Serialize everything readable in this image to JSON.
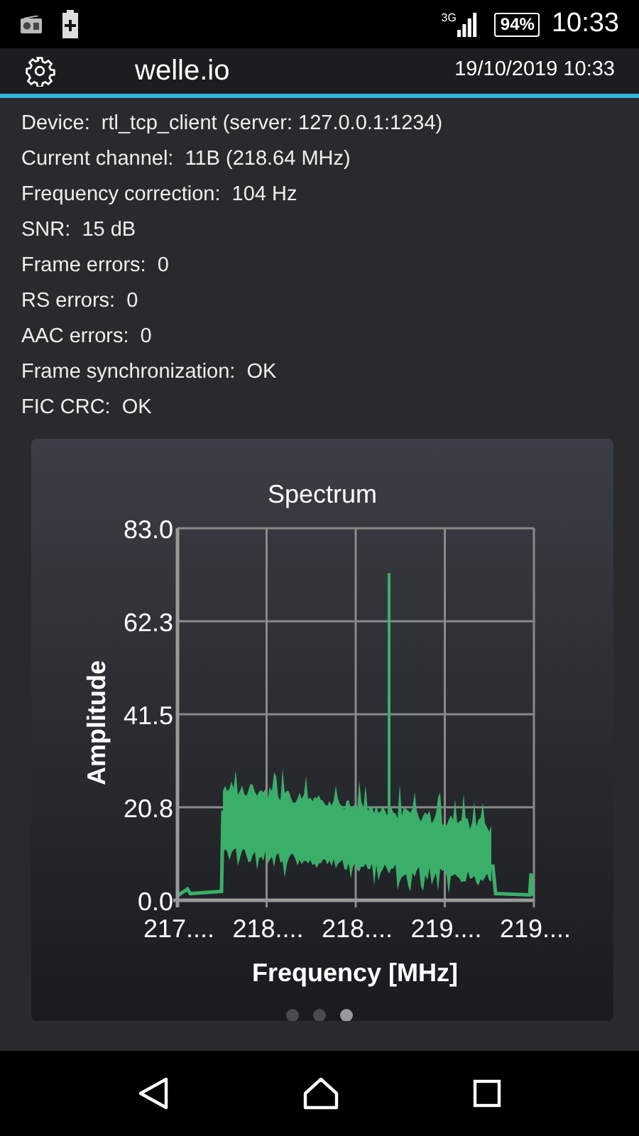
{
  "status_bar": {
    "network": "3G",
    "battery": "94%",
    "time": "10:33"
  },
  "app_bar": {
    "title": "welle.io",
    "datetime": "19/10/2019 10:33"
  },
  "info": [
    {
      "label": "Device:",
      "value": "rtl_tcp_client (server: 127.0.0.1:1234)"
    },
    {
      "label": "Current channel:",
      "value": "11B (218.64 MHz)"
    },
    {
      "label": "Frequency correction:",
      "value": "104 Hz"
    },
    {
      "label": "SNR:",
      "value": "15 dB"
    },
    {
      "label": "Frame errors:",
      "value": "0"
    },
    {
      "label": "RS errors:",
      "value": "0"
    },
    {
      "label": "AAC errors:",
      "value": "0"
    },
    {
      "label": "Frame synchronization:",
      "value": "OK"
    },
    {
      "label": "FIC CRC:",
      "value": "OK"
    }
  ],
  "spectrum": {
    "title": "Spectrum",
    "ylabel": "Amplitude",
    "xlabel": "Frequency [MHz]",
    "yticks": [
      "83.0",
      "62.3",
      "41.5",
      "20.8",
      "0.0"
    ],
    "xticks": [
      "217....",
      "218....",
      "218....",
      "219....",
      "219...."
    ]
  },
  "pages": [
    {
      "selected": false
    },
    {
      "selected": false
    },
    {
      "selected": true
    }
  ]
}
